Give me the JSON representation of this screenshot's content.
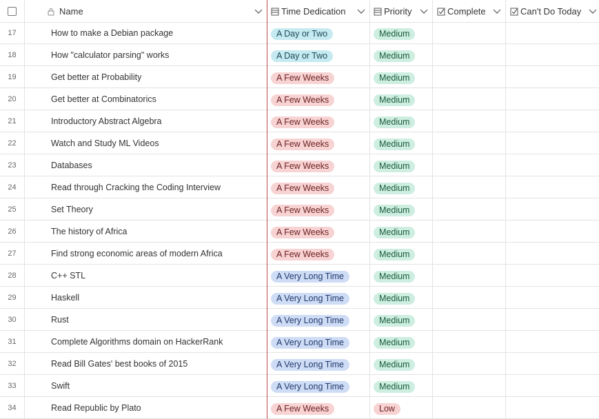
{
  "columns": {
    "name": "Name",
    "time": "Time Dedication",
    "priority": "Priority",
    "complete": "Complete",
    "cant": "Can't Do Today"
  },
  "rows": [
    {
      "num": "17",
      "name": "How to make a Debian package",
      "time": "A Day or Two",
      "priority": "Medium"
    },
    {
      "num": "18",
      "name": "How \"calculator parsing\" works",
      "time": "A Day or Two",
      "priority": "Medium"
    },
    {
      "num": "19",
      "name": "Get better at Probability",
      "time": "A Few Weeks",
      "priority": "Medium"
    },
    {
      "num": "20",
      "name": "Get better at Combinatorics",
      "time": "A Few Weeks",
      "priority": "Medium"
    },
    {
      "num": "21",
      "name": "Introductory Abstract Algebra",
      "time": "A Few Weeks",
      "priority": "Medium"
    },
    {
      "num": "22",
      "name": "Watch and Study ML Videos",
      "time": "A Few Weeks",
      "priority": "Medium"
    },
    {
      "num": "23",
      "name": "Databases",
      "time": "A Few Weeks",
      "priority": "Medium"
    },
    {
      "num": "24",
      "name": "Read through Cracking the Coding Interview",
      "time": "A Few Weeks",
      "priority": "Medium"
    },
    {
      "num": "25",
      "name": "Set Theory",
      "time": "A Few Weeks",
      "priority": "Medium"
    },
    {
      "num": "26",
      "name": "The history of Africa",
      "time": "A Few Weeks",
      "priority": "Medium"
    },
    {
      "num": "27",
      "name": "Find strong economic areas of modern Africa",
      "time": "A Few Weeks",
      "priority": "Medium"
    },
    {
      "num": "28",
      "name": "C++ STL",
      "time": "A Very Long Time",
      "priority": "Medium"
    },
    {
      "num": "29",
      "name": "Haskell",
      "time": "A Very Long Time",
      "priority": "Medium"
    },
    {
      "num": "30",
      "name": "Rust",
      "time": "A Very Long Time",
      "priority": "Medium"
    },
    {
      "num": "31",
      "name": "Complete Algorithms domain on HackerRank",
      "time": "A Very Long Time",
      "priority": "Medium"
    },
    {
      "num": "32",
      "name": "Read Bill Gates' best books of 2015",
      "time": "A Very Long Time",
      "priority": "Medium"
    },
    {
      "num": "33",
      "name": "Swift",
      "time": "A Very Long Time",
      "priority": "Medium"
    },
    {
      "num": "34",
      "name": "Read Republic by Plato",
      "time": "A Few Weeks",
      "priority": "Low"
    }
  ],
  "colors": {
    "frozen_divider": "#b84a4a",
    "day_pill": "#c6eaf1",
    "weeks_pill": "#f8d3d3",
    "long_pill": "#cfdcf5",
    "medium_pill": "#cdeee0"
  }
}
